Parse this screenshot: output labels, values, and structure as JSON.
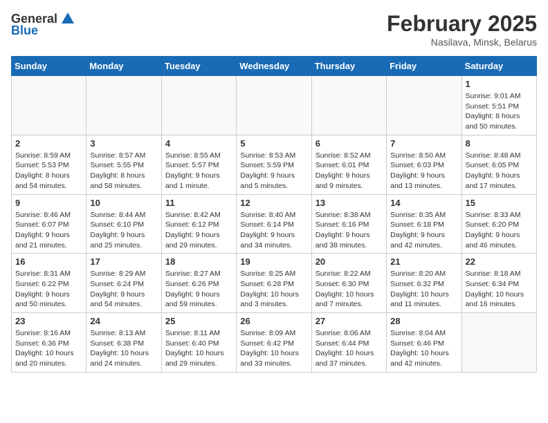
{
  "logo": {
    "general": "General",
    "blue": "Blue"
  },
  "title": "February 2025",
  "location": "Nasilava, Minsk, Belarus",
  "weekdays": [
    "Sunday",
    "Monday",
    "Tuesday",
    "Wednesday",
    "Thursday",
    "Friday",
    "Saturday"
  ],
  "weeks": [
    [
      {
        "day": "",
        "info": ""
      },
      {
        "day": "",
        "info": ""
      },
      {
        "day": "",
        "info": ""
      },
      {
        "day": "",
        "info": ""
      },
      {
        "day": "",
        "info": ""
      },
      {
        "day": "",
        "info": ""
      },
      {
        "day": "1",
        "info": "Sunrise: 9:01 AM\nSunset: 5:51 PM\nDaylight: 8 hours and 50 minutes."
      }
    ],
    [
      {
        "day": "2",
        "info": "Sunrise: 8:59 AM\nSunset: 5:53 PM\nDaylight: 8 hours and 54 minutes."
      },
      {
        "day": "3",
        "info": "Sunrise: 8:57 AM\nSunset: 5:55 PM\nDaylight: 8 hours and 58 minutes."
      },
      {
        "day": "4",
        "info": "Sunrise: 8:55 AM\nSunset: 5:57 PM\nDaylight: 9 hours and 1 minute."
      },
      {
        "day": "5",
        "info": "Sunrise: 8:53 AM\nSunset: 5:59 PM\nDaylight: 9 hours and 5 minutes."
      },
      {
        "day": "6",
        "info": "Sunrise: 8:52 AM\nSunset: 6:01 PM\nDaylight: 9 hours and 9 minutes."
      },
      {
        "day": "7",
        "info": "Sunrise: 8:50 AM\nSunset: 6:03 PM\nDaylight: 9 hours and 13 minutes."
      },
      {
        "day": "8",
        "info": "Sunrise: 8:48 AM\nSunset: 6:05 PM\nDaylight: 9 hours and 17 minutes."
      }
    ],
    [
      {
        "day": "9",
        "info": "Sunrise: 8:46 AM\nSunset: 6:07 PM\nDaylight: 9 hours and 21 minutes."
      },
      {
        "day": "10",
        "info": "Sunrise: 8:44 AM\nSunset: 6:10 PM\nDaylight: 9 hours and 25 minutes."
      },
      {
        "day": "11",
        "info": "Sunrise: 8:42 AM\nSunset: 6:12 PM\nDaylight: 9 hours and 29 minutes."
      },
      {
        "day": "12",
        "info": "Sunrise: 8:40 AM\nSunset: 6:14 PM\nDaylight: 9 hours and 34 minutes."
      },
      {
        "day": "13",
        "info": "Sunrise: 8:38 AM\nSunset: 6:16 PM\nDaylight: 9 hours and 38 minutes."
      },
      {
        "day": "14",
        "info": "Sunrise: 8:35 AM\nSunset: 6:18 PM\nDaylight: 9 hours and 42 minutes."
      },
      {
        "day": "15",
        "info": "Sunrise: 8:33 AM\nSunset: 6:20 PM\nDaylight: 9 hours and 46 minutes."
      }
    ],
    [
      {
        "day": "16",
        "info": "Sunrise: 8:31 AM\nSunset: 6:22 PM\nDaylight: 9 hours and 50 minutes."
      },
      {
        "day": "17",
        "info": "Sunrise: 8:29 AM\nSunset: 6:24 PM\nDaylight: 9 hours and 54 minutes."
      },
      {
        "day": "18",
        "info": "Sunrise: 8:27 AM\nSunset: 6:26 PM\nDaylight: 9 hours and 59 minutes."
      },
      {
        "day": "19",
        "info": "Sunrise: 8:25 AM\nSunset: 6:28 PM\nDaylight: 10 hours and 3 minutes."
      },
      {
        "day": "20",
        "info": "Sunrise: 8:22 AM\nSunset: 6:30 PM\nDaylight: 10 hours and 7 minutes."
      },
      {
        "day": "21",
        "info": "Sunrise: 8:20 AM\nSunset: 6:32 PM\nDaylight: 10 hours and 11 minutes."
      },
      {
        "day": "22",
        "info": "Sunrise: 8:18 AM\nSunset: 6:34 PM\nDaylight: 10 hours and 16 minutes."
      }
    ],
    [
      {
        "day": "23",
        "info": "Sunrise: 8:16 AM\nSunset: 6:36 PM\nDaylight: 10 hours and 20 minutes."
      },
      {
        "day": "24",
        "info": "Sunrise: 8:13 AM\nSunset: 6:38 PM\nDaylight: 10 hours and 24 minutes."
      },
      {
        "day": "25",
        "info": "Sunrise: 8:11 AM\nSunset: 6:40 PM\nDaylight: 10 hours and 29 minutes."
      },
      {
        "day": "26",
        "info": "Sunrise: 8:09 AM\nSunset: 6:42 PM\nDaylight: 10 hours and 33 minutes."
      },
      {
        "day": "27",
        "info": "Sunrise: 8:06 AM\nSunset: 6:44 PM\nDaylight: 10 hours and 37 minutes."
      },
      {
        "day": "28",
        "info": "Sunrise: 8:04 AM\nSunset: 6:46 PM\nDaylight: 10 hours and 42 minutes."
      },
      {
        "day": "",
        "info": ""
      }
    ]
  ]
}
